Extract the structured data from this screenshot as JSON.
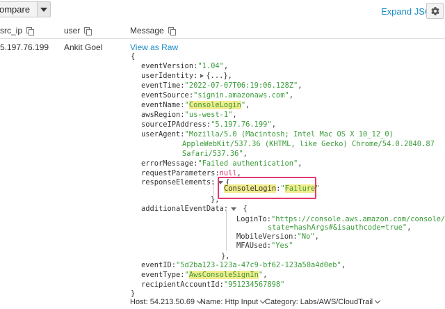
{
  "toolbar": {
    "compare_label": "ompare",
    "expand_json_label": "Expand JSON",
    "icons": {
      "dropdown": "caret-down-icon",
      "settings": "gear-icon"
    }
  },
  "columns": {
    "src_ip": "src_ip",
    "user": "user",
    "message": "Message"
  },
  "row": {
    "src_ip": "5.197.76.199",
    "user": "Ankit Goel",
    "view_raw": "View as Raw"
  },
  "json": {
    "open_brace": "{",
    "close_brace": "}",
    "eventVersion_key": "eventVersion:",
    "eventVersion_val": "\"1.04\"",
    "userIdentity_key": "userIdentity:",
    "userIdentity_val": "{...},",
    "eventTime_key": "eventTime:",
    "eventTime_val": "\"2022-07-07T06:19:06.128Z\"",
    "eventSource_key": "eventSource:",
    "eventSource_val": "\"signin.amazonaws.com\"",
    "eventName_key": "eventName:",
    "eventName_q1": "\"",
    "eventName_val": "ConsoleLogin",
    "eventName_q2": "\"",
    "awsRegion_key": "awsRegion:",
    "awsRegion_val": "\"us-west-1\"",
    "sourceIPAddress_key": "sourceIPAddress:",
    "sourceIPAddress_val": "\"5.197.76.199\"",
    "userAgent_key": "userAgent:",
    "userAgent_line1": "\"Mozilla/5.0 (Macintosh; Intel Mac OS X 10_12_0)",
    "userAgent_line2": "AppleWebKit/537.36 (KHTML, like Gecko) Chrome/54.0.2840.87",
    "userAgent_line3": "Safari/537.36\"",
    "errorMessage_key": "errorMessage:",
    "errorMessage_val": "\"Failed authentication\"",
    "requestParameters_key": "requestParameters:",
    "requestParameters_val": "null",
    "responseElements_key": "responseElements:",
    "consoleLogin_key": "ConsoleLogin",
    "consoleLogin_colon": ":",
    "consoleLogin_q1": "\"",
    "consoleLogin_val": "Failure",
    "consoleLogin_q2": "\"",
    "inner_close": "},",
    "additionalEventData_key": "additionalEventData:",
    "loginTo_key": "LoginTo:",
    "loginTo_line1": "\"https://console.aws.amazon.com/console/home?",
    "loginTo_line2": "state=hashArgs#&isauthcode=true\"",
    "mobileVersion_key": "MobileVersion:",
    "mobileVersion_val": "\"No\"",
    "mfaUsed_key": "MFAUsed:",
    "mfaUsed_val": "\"Yes\"",
    "eventID_key": "eventID:",
    "eventID_val": "\"5d2ba123-123a-47c9-bf62-123a50a4d0eb\"",
    "eventType_key": "eventType:",
    "eventType_q1": "\"",
    "eventType_val": "AwsConsoleSignIn",
    "eventType_q2": "\"",
    "recipientAccountId_key": "recipientAccountId:",
    "recipientAccountId_val": "\"951234567898\""
  },
  "footer": {
    "host": "Host: 54.213.50.69",
    "name": "Name: Http Input",
    "category": "Category: Labs/AWS/CloudTrail"
  },
  "colors": {
    "link": "#1a8cc8",
    "string": "#3a9a3a",
    "null": "#d6336c",
    "highlight": "#f1ec8c",
    "box": "#e23a72"
  }
}
